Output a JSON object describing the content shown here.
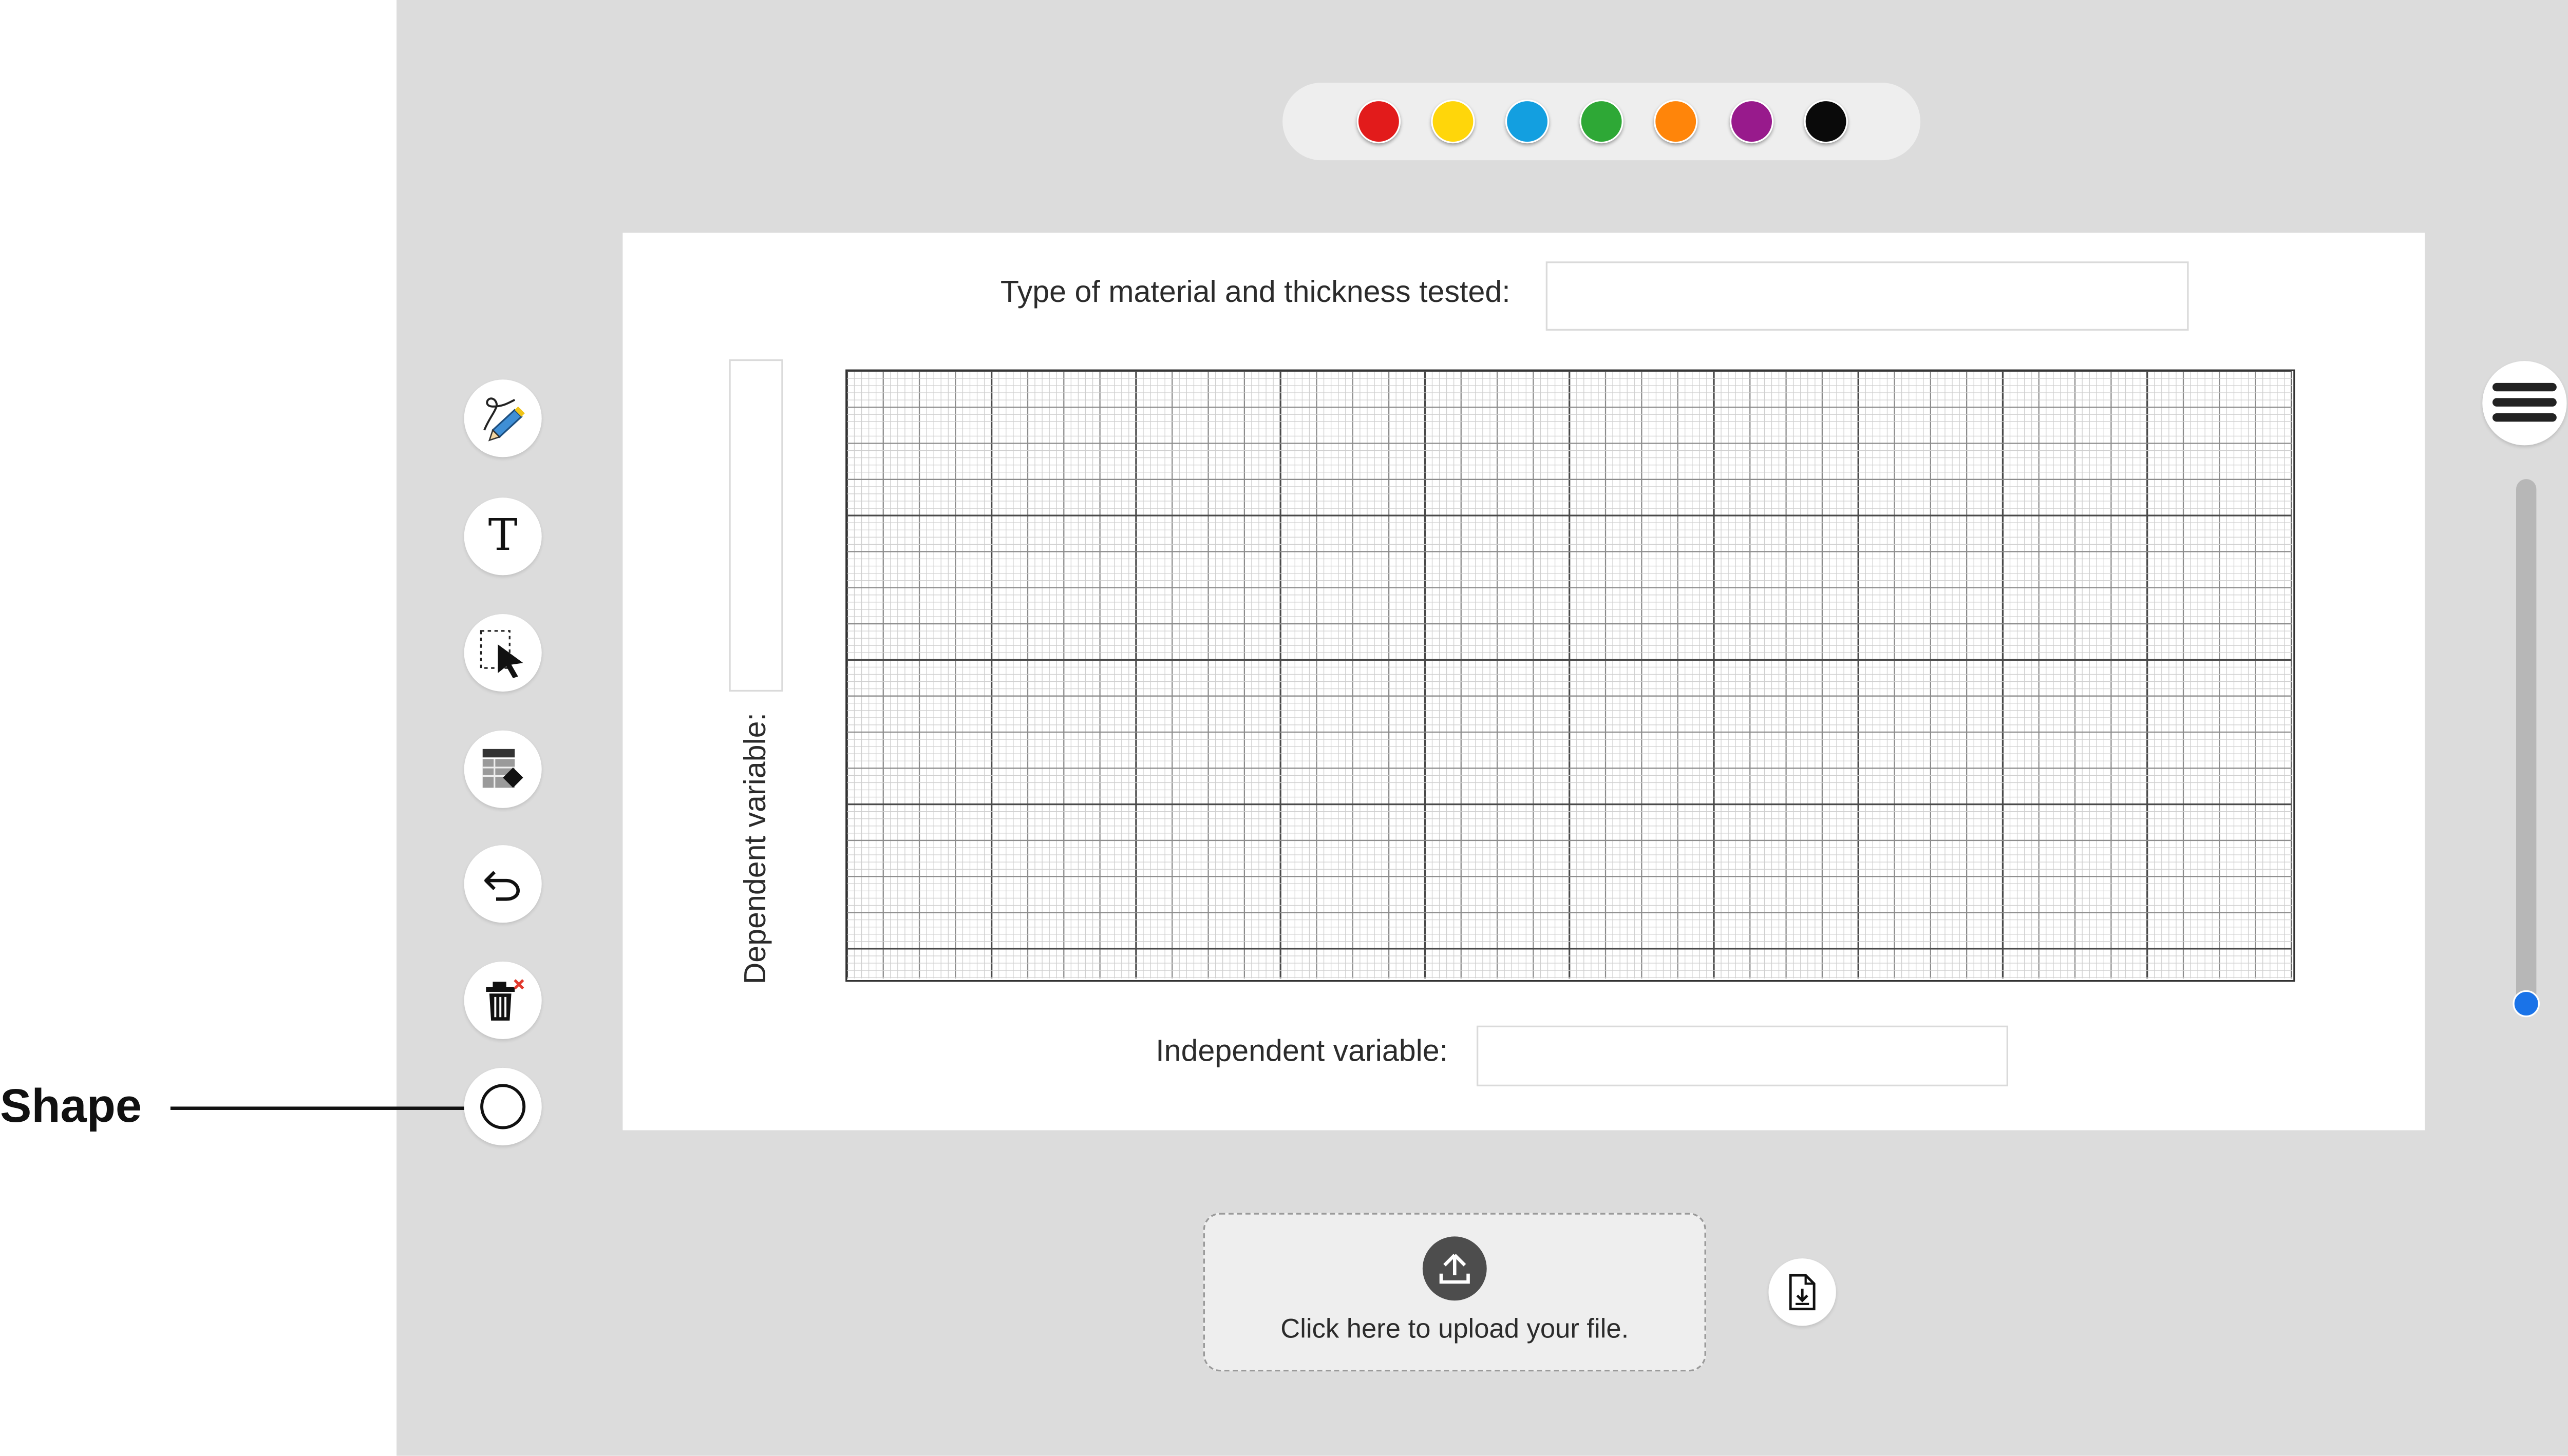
{
  "callout": {
    "label": "Shape"
  },
  "palette": {
    "colors": [
      {
        "name": "red",
        "hex": "#e21b1b"
      },
      {
        "name": "yellow",
        "hex": "#ffd60a"
      },
      {
        "name": "blue",
        "hex": "#139fe0"
      },
      {
        "name": "green",
        "hex": "#2ea836"
      },
      {
        "name": "orange",
        "hex": "#ff850a"
      },
      {
        "name": "purple",
        "hex": "#981a8c"
      },
      {
        "name": "black",
        "hex": "#0a0a0a"
      }
    ]
  },
  "toolbar": {
    "tools": [
      {
        "name": "pen-tool",
        "icon": "pen-icon"
      },
      {
        "name": "text-tool",
        "icon": "text-t-icon",
        "glyph": "T"
      },
      {
        "name": "select-tool",
        "icon": "selection-cursor-icon"
      },
      {
        "name": "table-tool",
        "icon": "table-icon"
      },
      {
        "name": "undo-tool",
        "icon": "undo-icon"
      },
      {
        "name": "delete-tool",
        "icon": "trash-icon"
      },
      {
        "name": "shape-tool",
        "icon": "circle-icon"
      }
    ]
  },
  "worksheet": {
    "material_label": "Type of material and thickness tested:",
    "material_value": "",
    "dependent_label": "Dependent variable:",
    "dependent_value": "",
    "independent_label": "Independent variable:",
    "independent_value": ""
  },
  "upload": {
    "text": "Click here to upload your file."
  },
  "sidebar": {
    "menu_icon": "menu-icon",
    "slider_level": 1.0
  }
}
